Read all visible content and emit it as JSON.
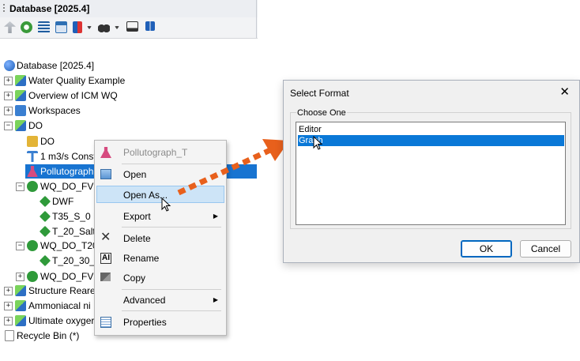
{
  "panel": {
    "title": "Database [2025.4]",
    "toolbar_icons": [
      "up-arrow-icon",
      "refresh-icon",
      "grid-icon",
      "window-grid-icon",
      "sort-icon",
      "binoculars-icon",
      "monitor-icon",
      "network-icon"
    ]
  },
  "tree": {
    "root": "Database [2025.4]",
    "items": [
      {
        "label": "Water Quality Example"
      },
      {
        "label": "Overview of ICM WQ"
      },
      {
        "label": "Workspaces"
      },
      {
        "label": "DO"
      },
      {
        "label": "DO"
      },
      {
        "label": "1 m3/s Const"
      },
      {
        "label": "Pollutograph"
      },
      {
        "label": "WQ_DO_FV"
      },
      {
        "label": "DWF"
      },
      {
        "label": "T35_S_0 D"
      },
      {
        "label": "T_20_Salt_"
      },
      {
        "label": "WQ_DO_T20"
      },
      {
        "label": "T_20_30_3"
      },
      {
        "label": "WQ_DO_FV!"
      },
      {
        "label": "Structure Reare"
      },
      {
        "label": "Ammoniacal ni"
      },
      {
        "label": "Ultimate oxyger"
      },
      {
        "label": "Recycle Bin (*)"
      }
    ]
  },
  "context_menu": {
    "header": "Pollutograph_T",
    "items": [
      {
        "label": "Open"
      },
      {
        "label": "Open As..."
      },
      {
        "label": "Export"
      },
      {
        "label": "Delete"
      },
      {
        "label": "Rename"
      },
      {
        "label": "Copy"
      },
      {
        "label": "Advanced"
      },
      {
        "label": "Properties"
      }
    ]
  },
  "dialog": {
    "title": "Select Format",
    "close": "✕",
    "group_label": "Choose One",
    "options": [
      "Editor",
      "Graph"
    ],
    "selected": "Graph",
    "ok": "OK",
    "cancel": "Cancel"
  },
  "colors": {
    "arrow": "#e8601c",
    "selection": "#1874d1",
    "menu_highlight": "#cde4f7"
  }
}
